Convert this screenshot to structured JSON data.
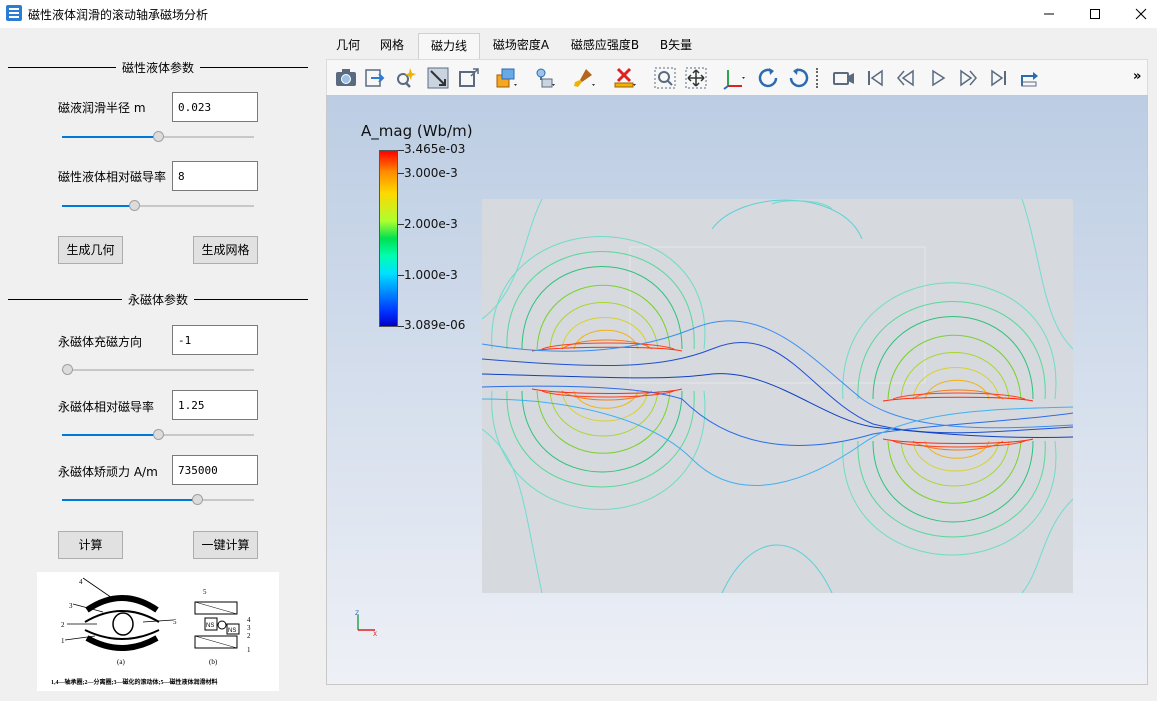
{
  "window": {
    "title": "磁性液体润滑的滚动轴承磁场分析"
  },
  "left_panel": {
    "group1_title": "磁性液体参数",
    "radius_label": "磁液润滑半径 m",
    "radius_value": "0.023",
    "radius_slider": 0.5,
    "permeability_label": "磁性液体相对磁导率",
    "permeability_value": "8",
    "permeability_slider": 0.37,
    "btn_geometry": "生成几何",
    "btn_mesh": "生成网格",
    "group2_title": "永磁体参数",
    "magnet_dir_label": "永磁体充磁方向",
    "magnet_dir_value": "-1",
    "magnet_dir_slider": 0.0,
    "magnet_perm_label": "永磁体相对磁导率",
    "magnet_perm_value": "1.25",
    "magnet_perm_slider": 0.5,
    "coercivity_label": "永磁体矫顽力 A/m",
    "coercivity_value": "735000",
    "coercivity_slider": 0.72,
    "btn_compute": "计算",
    "btn_one_click": "一键计算"
  },
  "figure": {
    "label_a": "(a)",
    "label_b": "(b)",
    "caption": "1,4—轴承圈;2—分离圈;3—磁化的滚动体;5—磁性液体润滑材料"
  },
  "tabs": [
    {
      "label": "几何",
      "active": false
    },
    {
      "label": "网格",
      "active": false
    },
    {
      "label": "磁力线",
      "active": true
    },
    {
      "label": "磁场密度A",
      "active": false
    },
    {
      "label": "磁感应强度B",
      "active": false
    },
    {
      "label": "B矢量",
      "active": false
    }
  ],
  "toolbar": {
    "icons": [
      "camera-icon",
      "export-icon",
      "zoom-wand-icon",
      "reset-view-icon",
      "fit-view-icon",
      "color-by-icon",
      "light-icon",
      "brush-icon",
      "clear-icon",
      "zoom-box-icon",
      "pan-icon",
      "axes-icon",
      "rotate-cw-icon",
      "rotate-ccw-icon",
      "record-icon",
      "first-frame-icon",
      "prev-frame-icon",
      "play-icon",
      "next-frame-icon",
      "last-frame-icon",
      "loop-icon",
      "overflow-icon"
    ],
    "overflow": "»"
  },
  "legend": {
    "title": "A_mag (Wb/m)",
    "max": "3.465e-03",
    "t3": "3.000e-3",
    "t2": "2.000e-3",
    "t1": "1.000e-3",
    "min": "3.089e-06",
    "axis_z": "Z",
    "axis_x": "X"
  }
}
